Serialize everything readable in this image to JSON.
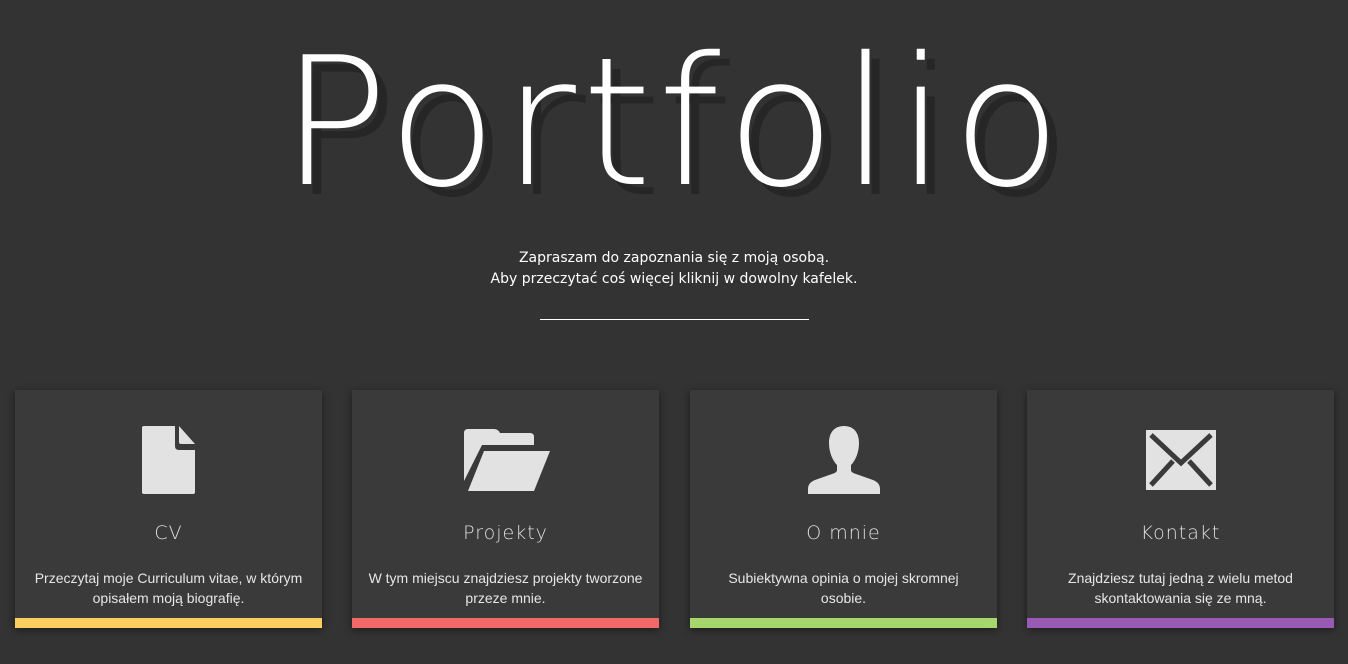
{
  "hero": {
    "title": "Portfolio",
    "intro_line_1": "Zapraszam do zapoznania się z moją osobą.",
    "intro_line_2": "Aby przeczytać coś więcej kliknij w dowolny kafelek."
  },
  "tiles": [
    {
      "icon": "document-icon",
      "title": "CV",
      "description": "Przeczytaj moje Curriculum vitae, w którym opisałem moją biografię.",
      "accent_color": "#fbcf5f"
    },
    {
      "icon": "folder-open-icon",
      "title": "Projekty",
      "description": "W tym miejscu znajdziesz projekty tworzone przeze mnie.",
      "accent_color": "#f26868"
    },
    {
      "icon": "user-icon",
      "title": "O mnie",
      "description": "Subiektywna opinia o mojej skromnej osobie.",
      "accent_color": "#a7d66c"
    },
    {
      "icon": "envelope-icon",
      "title": "Kontakt",
      "description": "Znajdziesz tutaj jedną z wielu metod skontaktowania się ze mną.",
      "accent_color": "#9b59b6"
    }
  ],
  "colors": {
    "background": "#333333",
    "tile_background": "#3a3a3a",
    "icon_color": "#e2e2e2"
  }
}
